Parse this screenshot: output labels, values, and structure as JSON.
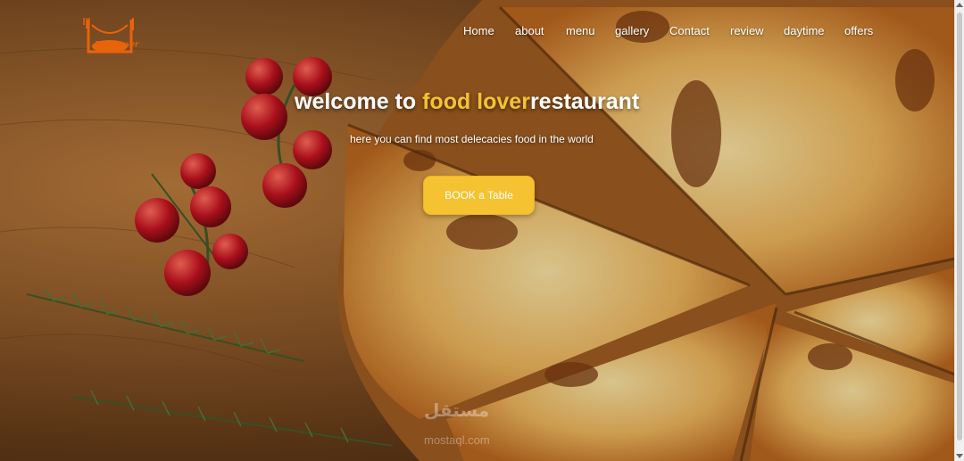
{
  "brand": {
    "logo_text": "Food Lover"
  },
  "nav": {
    "items": [
      {
        "label": "Home"
      },
      {
        "label": "about"
      },
      {
        "label": "menu"
      },
      {
        "label": "gallery"
      },
      {
        "label": "Contact"
      },
      {
        "label": "review"
      },
      {
        "label": "daytime"
      },
      {
        "label": "offers"
      }
    ]
  },
  "hero": {
    "headline_prefix": "welcome to ",
    "headline_accent": "food lover",
    "headline_suffix": "restaurant",
    "subtitle": "here you can find most delecacies food in the world",
    "cta_label": "BOOK a Table"
  },
  "watermark": {
    "text": "مستقل",
    "sub": "mostaql.com"
  },
  "colors": {
    "accent": "#f5c232",
    "logo": "#e8630a",
    "text": "#ffffff"
  }
}
